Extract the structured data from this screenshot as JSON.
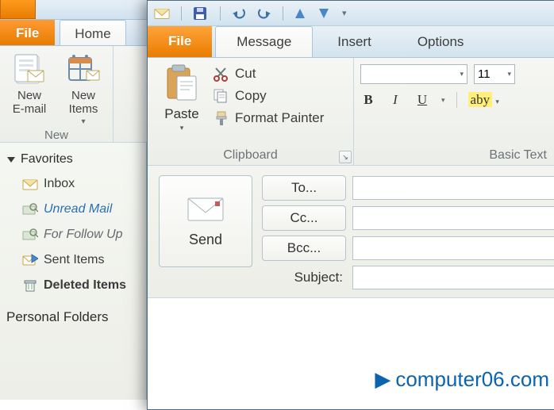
{
  "back": {
    "file_tab_label": "File",
    "home_tab_label": "Home",
    "group_name": "New",
    "btn_new_email": "New\nE-mail",
    "btn_new_items": "New\nItems"
  },
  "nav": {
    "favorites_label": "Favorites",
    "items": [
      {
        "label": "Inbox",
        "icon": "inbox",
        "style": "plain"
      },
      {
        "label": "Unread Mail",
        "icon": "search-folder",
        "style": "italic"
      },
      {
        "label": "For Follow Up",
        "icon": "search-folder",
        "style": "italic2"
      },
      {
        "label": "Sent Items",
        "icon": "sent",
        "style": "plain"
      },
      {
        "label": "Deleted Items",
        "icon": "trash",
        "style": "bold"
      }
    ],
    "footer_label": "Personal Folders"
  },
  "front": {
    "file_tab_label": "File",
    "tabs": [
      {
        "label": "Message",
        "active": true
      },
      {
        "label": "Insert",
        "active": false
      },
      {
        "label": "Options",
        "active": false
      }
    ],
    "clipboard": {
      "paste_label": "Paste",
      "cut_label": "Cut",
      "copy_label": "Copy",
      "format_painter_label": "Format Painter",
      "group_name": "Clipboard"
    },
    "basic_text": {
      "group_name": "Basic Text",
      "font_name": "",
      "font_size": "11",
      "bold_glyph": "B",
      "italic_glyph": "I",
      "underline_glyph": "U",
      "highlight_label": "aby"
    },
    "compose": {
      "send_label": "Send",
      "to_label": "To...",
      "cc_label": "Cc...",
      "bcc_label": "Bcc...",
      "subject_label": "Subject:"
    }
  },
  "watermark": "computer06.com"
}
